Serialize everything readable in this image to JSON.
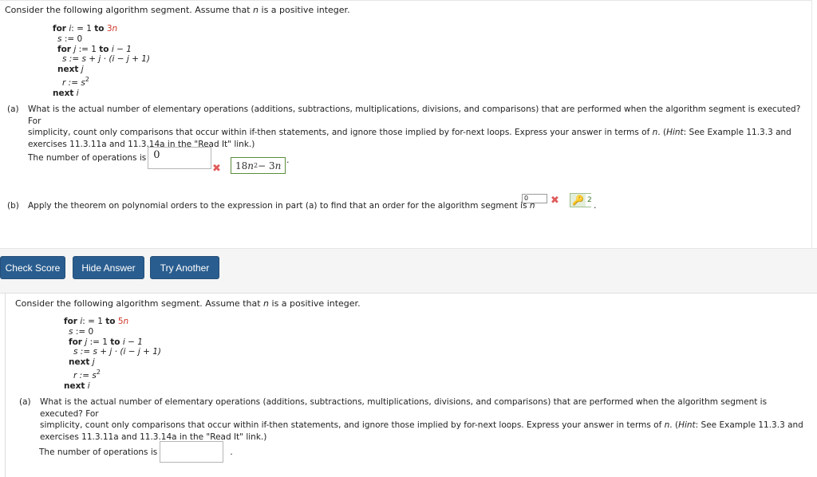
{
  "question1": {
    "intro": "Consider the following algorithm segment. Assume that n is a positive integer.",
    "intro_parts": {
      "before": "Consider the following algorithm segment. Assume that ",
      "var": "n",
      "after": " is a positive integer."
    },
    "algorithm": {
      "for_i": {
        "kw1": "for",
        "var": "i",
        "assign": ": = 1 ",
        "kw2": "to",
        "limit_coef": "3",
        "limit_var": "n"
      },
      "s_init": {
        "var": "s",
        "rest": " := 0"
      },
      "for_j": {
        "kw1": "for",
        "var": "j",
        "assign": " := 1 ",
        "kw2": "to",
        "limit": " i − 1"
      },
      "s_update": "s := s + j · (i − j + 1)",
      "next_j": {
        "kw": "next",
        "var": "j"
      },
      "r_assign": {
        "lhs": "r := s",
        "exp": "2"
      },
      "next_i": {
        "kw": "next",
        "var": "i"
      }
    },
    "part_a": {
      "label": "(a)",
      "line1": "What is the actual number of elementary operations (additions, subtractions, multiplications, divisions, and comparisons) that are performed when the algorithm segment is executed? For",
      "line2_before": "simplicity, count only comparisons that occur within if-then statements, and ignore those implied by for-next loops. Express your answer in terms of ",
      "line2_var": "n",
      "line2_mid": ". (",
      "line2_hint": "Hint",
      "line2_after": ": See Example 11.3.3 and",
      "line3": "exercises 11.3.11a and 11.3.14a in the \"Read It\" link.)",
      "answer_label": "The number of operations is",
      "answer_value": "0",
      "status": "incorrect",
      "correct_answer": "18n² − 3n",
      "correct_parts": {
        "coef": "18",
        "var": "n",
        "exp": "2",
        "rest": " − 3",
        "var2": "n"
      },
      "period": "."
    },
    "part_b": {
      "label": "(b)",
      "text_before": "Apply the theorem on polynomial orders to the expression in part (a) to find that an order for the algorithm segment is ",
      "base_var": "n",
      "exponent_value": "0",
      "status": "incorrect",
      "correct_exponent": "2",
      "period": "."
    }
  },
  "buttons": {
    "check_score": "Check Score",
    "hide_answer": "Hide Answer",
    "try_another": "Try Another"
  },
  "question2": {
    "intro_parts": {
      "before": "Consider the following algorithm segment. Assume that ",
      "var": "n",
      "after": " is a positive integer."
    },
    "algorithm": {
      "for_i": {
        "kw1": "for",
        "var": "i",
        "assign": ": = 1 ",
        "kw2": "to",
        "limit_coef": "5",
        "limit_var": "n"
      },
      "s_init": {
        "var": "s",
        "rest": " := 0"
      },
      "for_j": {
        "kw1": "for",
        "var": "j",
        "assign": " := 1 ",
        "kw2": "to",
        "limit": " i − 1"
      },
      "s_update": "s := s + j · (i − j + 1)",
      "next_j": {
        "kw": "next",
        "var": "j"
      },
      "r_assign": {
        "lhs": "r := s",
        "exp": "2"
      },
      "next_i": {
        "kw": "next",
        "var": "i"
      }
    },
    "part_a": {
      "label": "(a)",
      "line1": "What is the actual number of elementary operations (additions, subtractions, multiplications, divisions, and comparisons) that are performed when the algorithm segment is executed? For",
      "line2_before": "simplicity, count only comparisons that occur within if-then statements, and ignore those implied by for-next loops. Express your answer in terms of ",
      "line2_var": "n",
      "line2_mid": ". (",
      "line2_hint": "Hint",
      "line2_after": ": See Example 11.3.3 and",
      "line3": "exercises 11.3.11a and 11.3.14a in the \"Read It\" link.)",
      "answer_label": "The number of operations is",
      "answer_value": "",
      "period": "."
    }
  },
  "colors": {
    "button_bg": "#2a5d8f",
    "incorrect_mark": "#e05a5a",
    "correct_border": "#5a8e3a",
    "highlight_red": "#d0382b"
  }
}
